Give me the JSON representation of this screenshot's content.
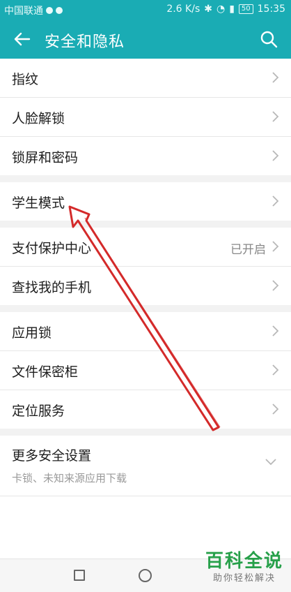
{
  "status_bar": {
    "carrier": "中国联通",
    "speed": "2.6 K/s",
    "battery": "50",
    "time": "15:35"
  },
  "header": {
    "title": "安全和隐私"
  },
  "groups": [
    {
      "items": [
        {
          "label": "指纹"
        },
        {
          "label": "人脸解锁"
        },
        {
          "label": "锁屏和密码"
        }
      ]
    },
    {
      "items": [
        {
          "label": "学生模式"
        }
      ]
    },
    {
      "items": [
        {
          "label": "支付保护中心",
          "value": "已开启"
        },
        {
          "label": "查找我的手机"
        }
      ]
    },
    {
      "items": [
        {
          "label": "应用锁"
        },
        {
          "label": "文件保密柜"
        },
        {
          "label": "定位服务"
        }
      ]
    },
    {
      "items": [
        {
          "label": "更多安全设置",
          "subtitle": "卡锁、未知来源应用下载"
        }
      ]
    }
  ],
  "watermark": {
    "title": "百科全说",
    "subtitle": "助你轻松解决"
  },
  "colors": {
    "accent": "#1aacb4",
    "annotation_arrow": "#d42a2a",
    "watermark": "#27a04a"
  }
}
